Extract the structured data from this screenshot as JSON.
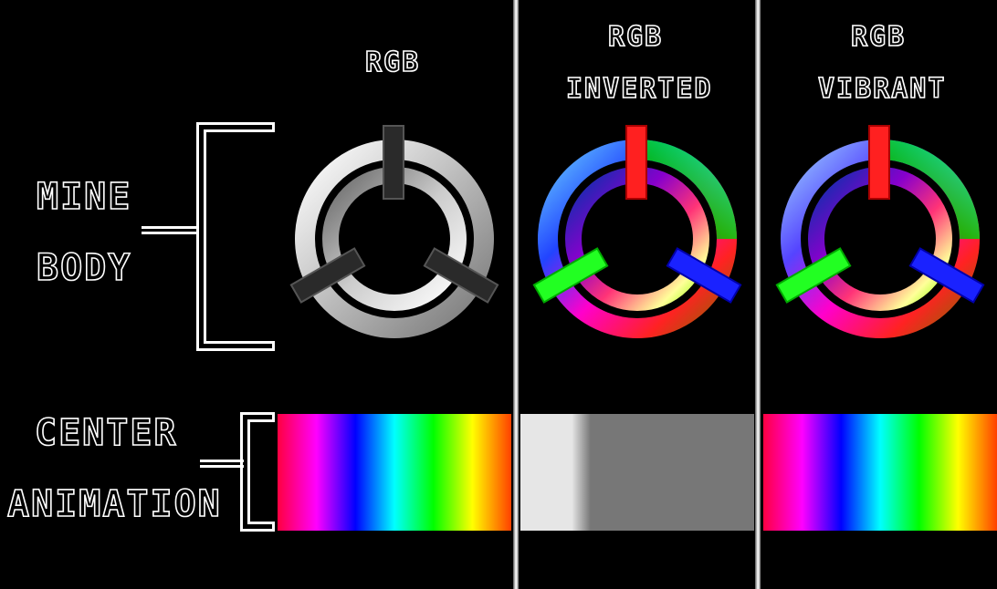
{
  "labels": {
    "mine": "MINE",
    "body": "BODY",
    "center": "CENTER",
    "animation": "ANIMATION"
  },
  "columns": [
    {
      "title": "RGB",
      "subtitle": ""
    },
    {
      "title": "RGB",
      "subtitle": "INVERTED"
    },
    {
      "title": "RGB",
      "subtitle": "VIBRANT"
    }
  ],
  "colors": {
    "background": "#000000",
    "outline": "#ffffff",
    "spoke_top_color": "#ff2020",
    "spoke_left_color": "#22ff22",
    "spoke_right_color": "#1a22ff",
    "spoke_gray": "#2a2a2a"
  },
  "strips": {
    "rgb": [
      "#ff0040",
      "#ff00ff",
      "#0000ff",
      "#00ffff",
      "#00ff00",
      "#ffff00",
      "#ff4000"
    ],
    "inverted": [
      "#e6e6e6",
      "#777777"
    ],
    "vibrant": [
      "#ff0040",
      "#ff00ff",
      "#0000ff",
      "#00ffff",
      "#00ff00",
      "#ffff00",
      "#ff4000"
    ]
  }
}
